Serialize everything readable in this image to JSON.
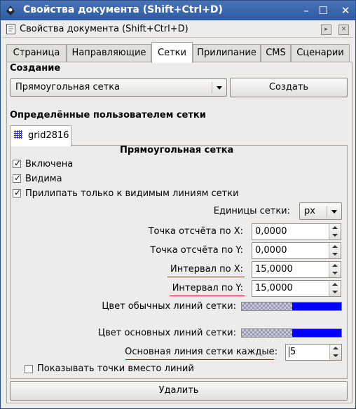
{
  "window": {
    "title": "Свойства документа (Shift+Ctrl+D)"
  },
  "dock": {
    "title": "Свойства документа (Shift+Ctrl+D)"
  },
  "tabs": [
    {
      "label": "Страница"
    },
    {
      "label": "Направляющие"
    },
    {
      "label": "Сетки",
      "active": true
    },
    {
      "label": "Прилипание"
    },
    {
      "label": "CMS"
    },
    {
      "label": "Сценарии"
    }
  ],
  "creation": {
    "heading": "Создание",
    "grid_type_selected": "Прямоугольная сетка",
    "create_button": "Создать"
  },
  "user_grids": {
    "heading": "Определённые пользователем сетки",
    "grid_tab_label": "grid2816"
  },
  "grid": {
    "type_title": "Прямоугольная сетка",
    "enabled": {
      "label": "Включена",
      "checked": true
    },
    "visible": {
      "label": "Видима",
      "checked": true
    },
    "snap_visible": {
      "label": "Прилипать только к видимым линиям сетки",
      "checked": true
    },
    "units": {
      "label": "Единицы сетки:",
      "value": "px"
    },
    "origin_x": {
      "label": "Точка отсчёта по X:",
      "value": "0,0000"
    },
    "origin_y": {
      "label": "Точка отсчёта по Y:",
      "value": "0,0000"
    },
    "spacing_x": {
      "label": "Интервал по X:",
      "value": "15,0000"
    },
    "spacing_y": {
      "label": "Интервал по Y:",
      "value": "15,0000"
    },
    "minor_color": {
      "label": "Цвет обычных линий сетки:",
      "color": "#0000ff"
    },
    "major_color": {
      "label": "Цвет основных линий сетки:",
      "color": "#0000ff"
    },
    "major_every": {
      "label": "Основная линия сетки каждые:",
      "value": "5"
    },
    "show_dots": {
      "label": "Показывать точки вместо линий",
      "checked": false
    }
  },
  "delete_button": "Удалить",
  "colors": {
    "titlebar": "#2c5aa3",
    "annotation_underline": "#d00000"
  }
}
